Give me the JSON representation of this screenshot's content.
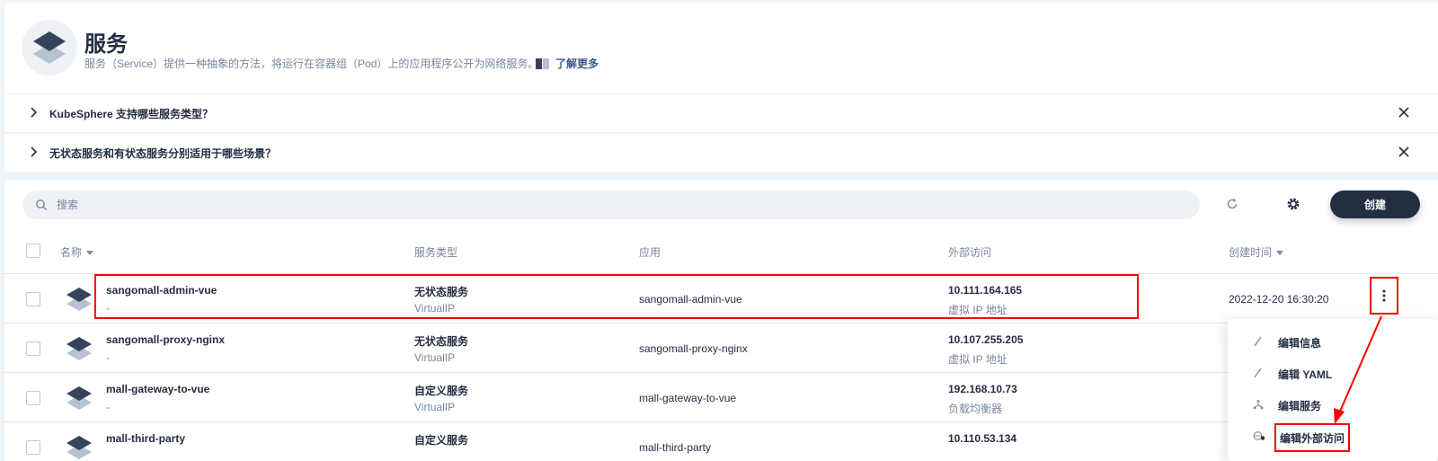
{
  "banner": {
    "title": "服务",
    "description": "服务（Service）提供一种抽象的方法，将运行在容器组（Pod）上的应用程序公开为网络服务。",
    "learn_more": "了解更多"
  },
  "faq": [
    {
      "text": "KubeSphere 支持哪些服务类型？"
    },
    {
      "text": "无状态服务和有状态服务分别适用于哪些场景？"
    }
  ],
  "toolbar": {
    "search_placeholder": "搜索",
    "create_label": "创建"
  },
  "table": {
    "columns": {
      "name": "名称",
      "service_type": "服务类型",
      "app": "应用",
      "external_access": "外部访问",
      "created_at": "创建时间"
    },
    "rows": [
      {
        "name": "sangomall-admin-vue",
        "sub": "-",
        "type": "无状态服务",
        "type_sub": "VirtualIP",
        "app": "sangomall-admin-vue",
        "ip": "10.111.164.165",
        "ip_sub": "虚拟 IP 地址",
        "created": "2022-12-20 16:30:20"
      },
      {
        "name": "sangomall-proxy-nginx",
        "sub": "-",
        "type": "无状态服务",
        "type_sub": "VirtualIP",
        "app": "sangomall-proxy-nginx",
        "ip": "10.107.255.205",
        "ip_sub": "虚拟 IP 地址",
        "created": ""
      },
      {
        "name": "mall-gateway-to-vue",
        "sub": "-",
        "type": "自定义服务",
        "type_sub": "VirtualIP",
        "app": "mall-gateway-to-vue",
        "ip": "192.168.10.73",
        "ip_sub": "负载均衡器",
        "created": ""
      },
      {
        "name": "mall-third-party",
        "sub": "",
        "type": "自定义服务",
        "type_sub": "",
        "app": "mall-third-party",
        "ip": "10.110.53.134",
        "ip_sub": "",
        "created": ""
      }
    ]
  },
  "menu": {
    "items": [
      {
        "label": "编辑信息",
        "icon": "pencil-icon"
      },
      {
        "label": "编辑 YAML",
        "icon": "pencil-icon"
      },
      {
        "label": "编辑服务",
        "icon": "topology-icon"
      },
      {
        "label": "编辑外部访问",
        "icon": "globe-pin-icon"
      }
    ]
  },
  "colors": {
    "accent": "#242e42",
    "highlight": "#ff0000",
    "link": "#3d5c8a"
  }
}
